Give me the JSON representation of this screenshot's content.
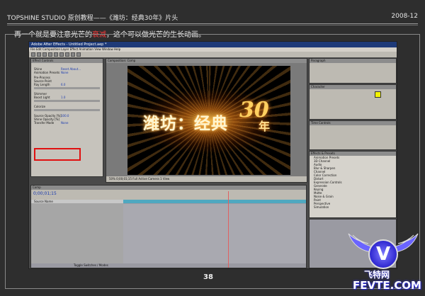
{
  "header": {
    "title": "TOPSHINE STUDIO 原创教程——《潍坊：经典30年》片头",
    "date": "2008-12"
  },
  "caption": {
    "before": "再一个就是要注意光芒的",
    "highlight": "衰减",
    "after": "，这个可以做光芒的生长动画。"
  },
  "page_number": "38",
  "app": {
    "title": "Adobe After Effects - Untitled Project.aep *",
    "menu": [
      "File",
      "Edit",
      "Composition",
      "Layer",
      "Effect",
      "Animation",
      "View",
      "Window",
      "Help"
    ],
    "effect_controls": {
      "tab": "Effect Controls",
      "rows": [
        {
          "label": "Shine",
          "value": "Reset  About..."
        },
        {
          "label": "Animation Presets",
          "value": "None"
        },
        {
          "label": "Pre-Process",
          "value": ""
        },
        {
          "label": "Source Point",
          "value": ""
        },
        {
          "label": "Ray Length",
          "value": "6.0"
        },
        {
          "label": "Shimmer",
          "value": ""
        },
        {
          "label": "Boost Light",
          "value": "1.0"
        },
        {
          "label": "Colorize",
          "value": ""
        },
        {
          "label": "Source Opacity [%]",
          "value": "100.0"
        },
        {
          "label": "Shine Opacity [%]",
          "value": ""
        },
        {
          "label": "Transfer Mode",
          "value": "None"
        }
      ]
    },
    "composition": {
      "tab": "Composition: Comp",
      "logo_text": "潍坊：经典",
      "logo_number": "30",
      "logo_suffix": "年",
      "footer": "50%   0;00;01;15   Full   Active Camera   1 View"
    },
    "right_panels": {
      "paragraph": "Paragraph",
      "character": "Character",
      "time_controls": "Time Controls",
      "effects_presets": "Effects & Presets",
      "effects_list": [
        "Animation Presets",
        "3D Channel",
        "Audio",
        "Blur & Sharpen",
        "Channel",
        "Color Correction",
        "Distort",
        "Expression Controls",
        "Generate",
        "Keying",
        "Matte",
        "Noise & Grain",
        "Paint",
        "Perspective",
        "Simulation"
      ]
    },
    "timeline": {
      "tab": "Comp",
      "timecode": "0;00;01;15",
      "layer": "Source Name",
      "footer": "Toggle Switches / Modes"
    }
  },
  "watermark": {
    "letter": "V",
    "cn": "飞特网",
    "en": "FEVTE.COM"
  }
}
